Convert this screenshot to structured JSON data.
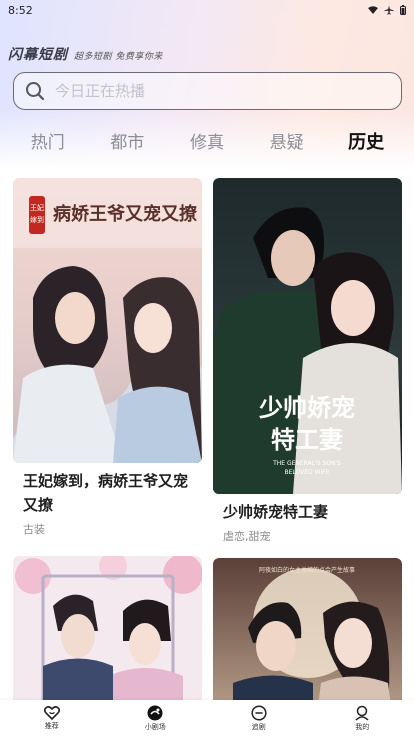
{
  "status_bar": {
    "time": "8:52"
  },
  "brand": {
    "logo": "闪幕短剧",
    "slogan": "超多短剧 免费享你来"
  },
  "search": {
    "placeholder": "今日正在热播"
  },
  "tabs": [
    {
      "label": "热门"
    },
    {
      "label": "都市"
    },
    {
      "label": "修真"
    },
    {
      "label": "悬疑"
    },
    {
      "label": "历史",
      "active": true
    }
  ],
  "cards": [
    {
      "title": "王妃嫁到，病娇王爷又宠又撩",
      "tag": "古装",
      "poster_text": "病娇王爷又宠又撩",
      "poster_badge": "王妃嫁到"
    },
    {
      "title": "少帅娇宠特工妻",
      "tag": "虐恋,甜宠",
      "poster_text_1": "少帅娇宠",
      "poster_text_2": "特工妻",
      "poster_sub_1": "THE GENERAL'S SON'S",
      "poster_sub_2": "BELOVED WIFE"
    },
    {
      "title": "",
      "tag": ""
    },
    {
      "title": "",
      "tag": "",
      "poster_text": "阿夜如白的女主总结的点会产生故事"
    }
  ],
  "bottom_nav": [
    {
      "label": "推荐",
      "icon": "heart-icon"
    },
    {
      "label": "小剧场",
      "icon": "theater-icon"
    },
    {
      "label": "追剧",
      "icon": "chat-icon"
    },
    {
      "label": "我的",
      "icon": "user-icon"
    }
  ],
  "colors": {
    "accent": "#ff7a2a",
    "tab_inactive": "#8d8d95"
  }
}
